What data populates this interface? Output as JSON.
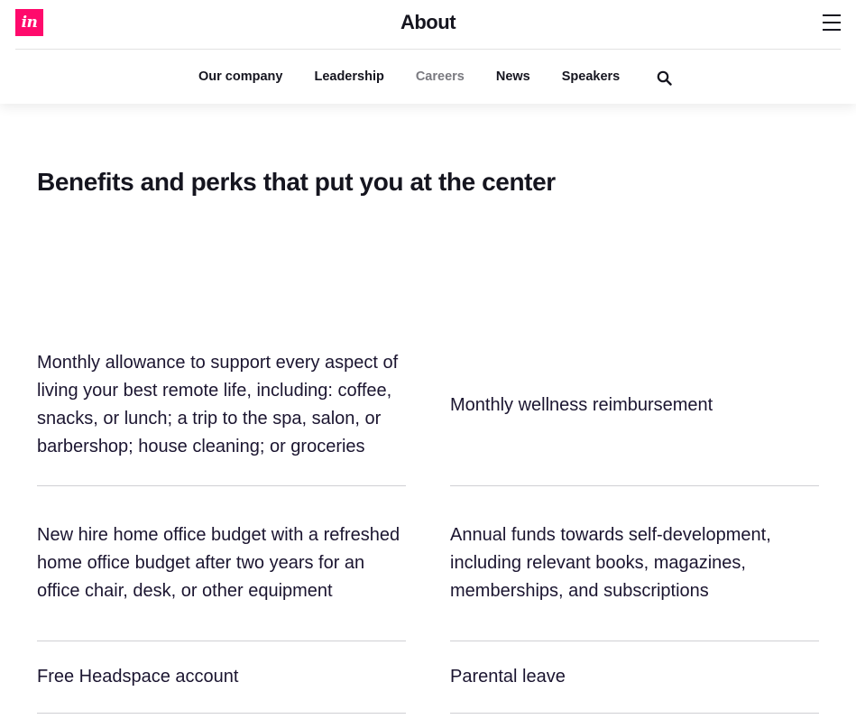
{
  "header": {
    "logo_text": "in",
    "logo_icon": "invision-logo",
    "title": "About",
    "menu_icon": "hamburger-menu-icon",
    "brand_color": "#ff0a6c"
  },
  "subnav": {
    "items": [
      {
        "label": "Our company",
        "active": false
      },
      {
        "label": "Leadership",
        "active": false
      },
      {
        "label": "Careers",
        "active": true
      },
      {
        "label": "News",
        "active": false
      },
      {
        "label": "Speakers",
        "active": false
      }
    ],
    "search_icon": "search-icon"
  },
  "main": {
    "title": "Benefits and perks that put you at the center",
    "benefits": [
      {
        "text": "Monthly allowance to support every aspect of living your best remote life, including: coffee, snacks, or lunch; a trip to the spa, salon, or barbershop; house cleaning; or groceries"
      },
      {
        "text": "Monthly wellness reimbursement"
      },
      {
        "text": "New hire home office budget with a refreshed home office budget after two years for an office chair, desk, or other equipment"
      },
      {
        "text": "Annual funds towards self-development, including relevant books, magazines, memberships, and subscriptions"
      },
      {
        "text": "Free Headspace account"
      },
      {
        "text": "Parental leave"
      }
    ]
  }
}
